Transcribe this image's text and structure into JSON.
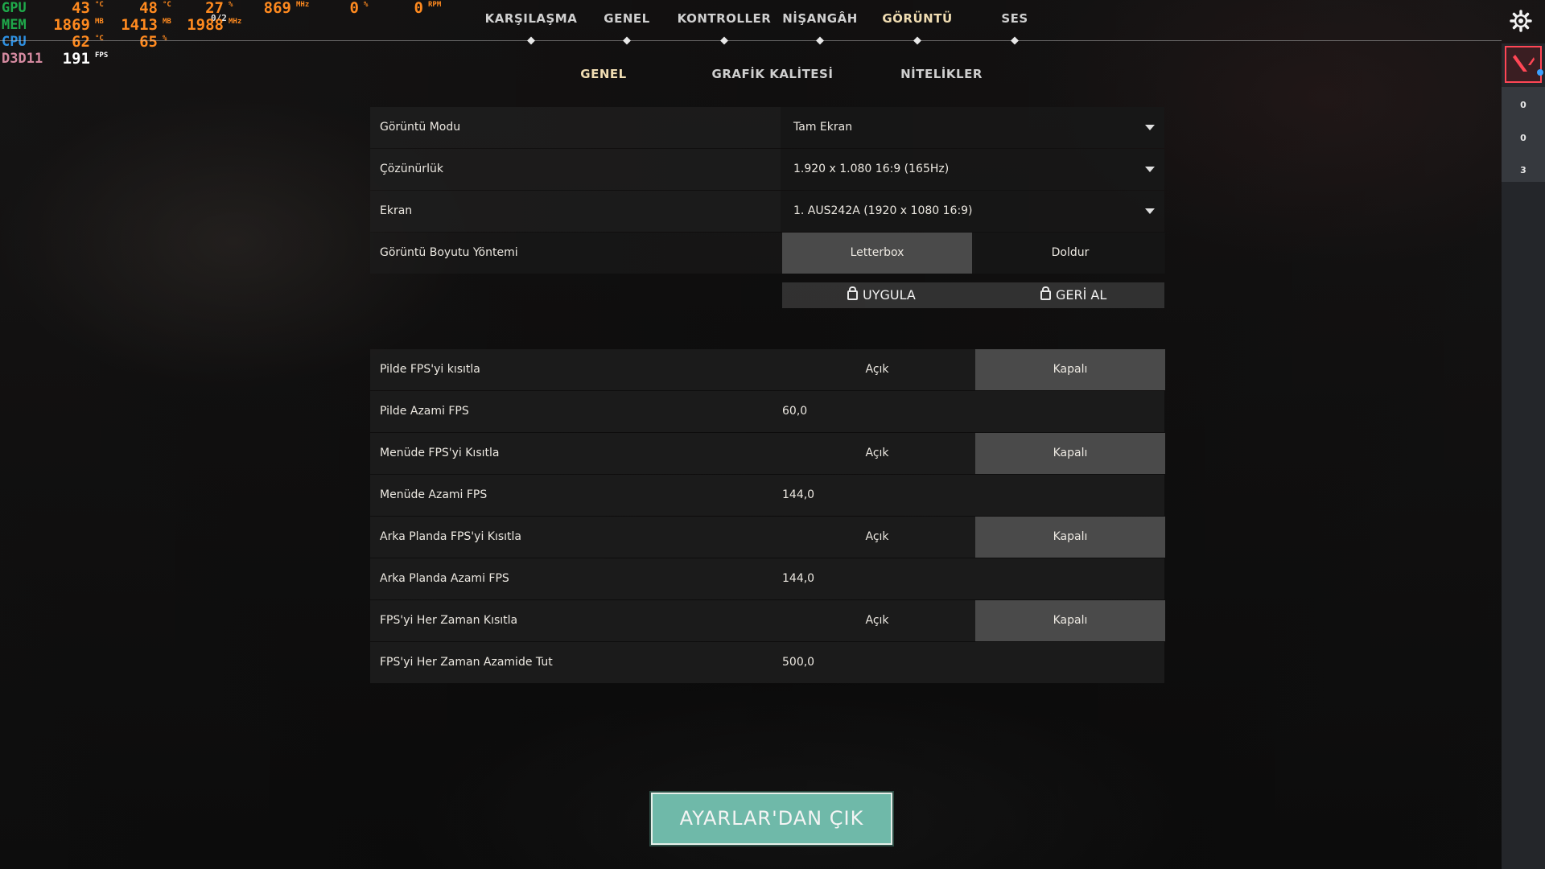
{
  "osd": {
    "gpu": {
      "label": "GPU",
      "temp": "43",
      "temp_unit": "°C",
      "hotspot": "48",
      "hotspot_unit": "°C",
      "load": "27",
      "load_unit": "%",
      "sub": "0/2",
      "clock": "869",
      "clock_unit": "MHz",
      "fan_pct": "0",
      "fan_pct_unit": "%",
      "fan_rpm": "0",
      "fan_rpm_unit": "RPM"
    },
    "mem": {
      "label": "MEM",
      "used": "1869",
      "used_unit": "MB",
      "vram": "1413",
      "vram_unit": "MB",
      "clock": "1988",
      "clock_unit": "MHz"
    },
    "cpu": {
      "label": "CPU",
      "temp": "62",
      "temp_unit": "°C",
      "load": "65",
      "load_unit": "%"
    },
    "api": {
      "label": "D3D11",
      "fps": "191",
      "fps_unit": "FPS"
    },
    "colors": {
      "gpu": "#1fa84a",
      "mem": "#1fa84a",
      "cpu": "#2e8fe0",
      "api": "#d58aa0",
      "value": "#ff8a1f"
    }
  },
  "nav": {
    "tabs": [
      "KARŞILAŞMA",
      "GENEL",
      "KONTROLLER",
      "NİŞANGÂH",
      "GÖRÜNTÜ",
      "SES"
    ],
    "active_tab": "GÖRÜNTÜ",
    "subtabs": [
      "GENEL",
      "GRAFİK KALİTESİ",
      "NİTELİKLER"
    ],
    "active_subtab": "GENEL",
    "settings_icon": "gear-icon"
  },
  "side": {
    "counts": [
      "0",
      "0",
      "3"
    ]
  },
  "display": {
    "mode": {
      "label": "Görüntü Modu",
      "value": "Tam Ekran"
    },
    "resolution": {
      "label": "Çözünürlük",
      "value": "1.920 x 1.080 16:9 (165Hz)"
    },
    "monitor": {
      "label": "Ekran",
      "value": "1. AUS242A (1920 x  1080 16:9)"
    },
    "aspect": {
      "label": "Görüntü Boyutu Yöntemi",
      "options": [
        "Letterbox",
        "Doldur"
      ],
      "selected": "Letterbox"
    },
    "apply_label": "UYGULA",
    "revert_label": "GERİ AL"
  },
  "fps": {
    "limit_battery": {
      "label": "Pilde FPS'yi kısıtla",
      "on": "Açık",
      "off": "Kapalı",
      "selected": "Kapalı"
    },
    "max_battery": {
      "label": "Pilde Azami FPS",
      "value": "60,0"
    },
    "limit_menu": {
      "label": "Menüde FPS'yi Kısıtla",
      "on": "Açık",
      "off": "Kapalı",
      "selected": "Kapalı"
    },
    "max_menu": {
      "label": "Menüde Azami FPS",
      "value": "144,0"
    },
    "limit_background": {
      "label": "Arka Planda FPS'yi Kısıtla",
      "on": "Açık",
      "off": "Kapalı",
      "selected": "Kapalı"
    },
    "max_background": {
      "label": "Arka Planda Azami FPS",
      "value": "144,0"
    },
    "limit_always": {
      "label": "FPS'yi Her Zaman Kısıtla",
      "on": "Açık",
      "off": "Kapalı",
      "selected": "Kapalı"
    },
    "max_always": {
      "label": "FPS'yi Her Zaman Azamide Tut",
      "value": "500,0"
    }
  },
  "exit_label": "AYARLAR'DAN ÇIK",
  "accent": {
    "exit_button": "#6fb9a9",
    "active_tab": "#f0ddb2",
    "brand": "#ff4655"
  }
}
